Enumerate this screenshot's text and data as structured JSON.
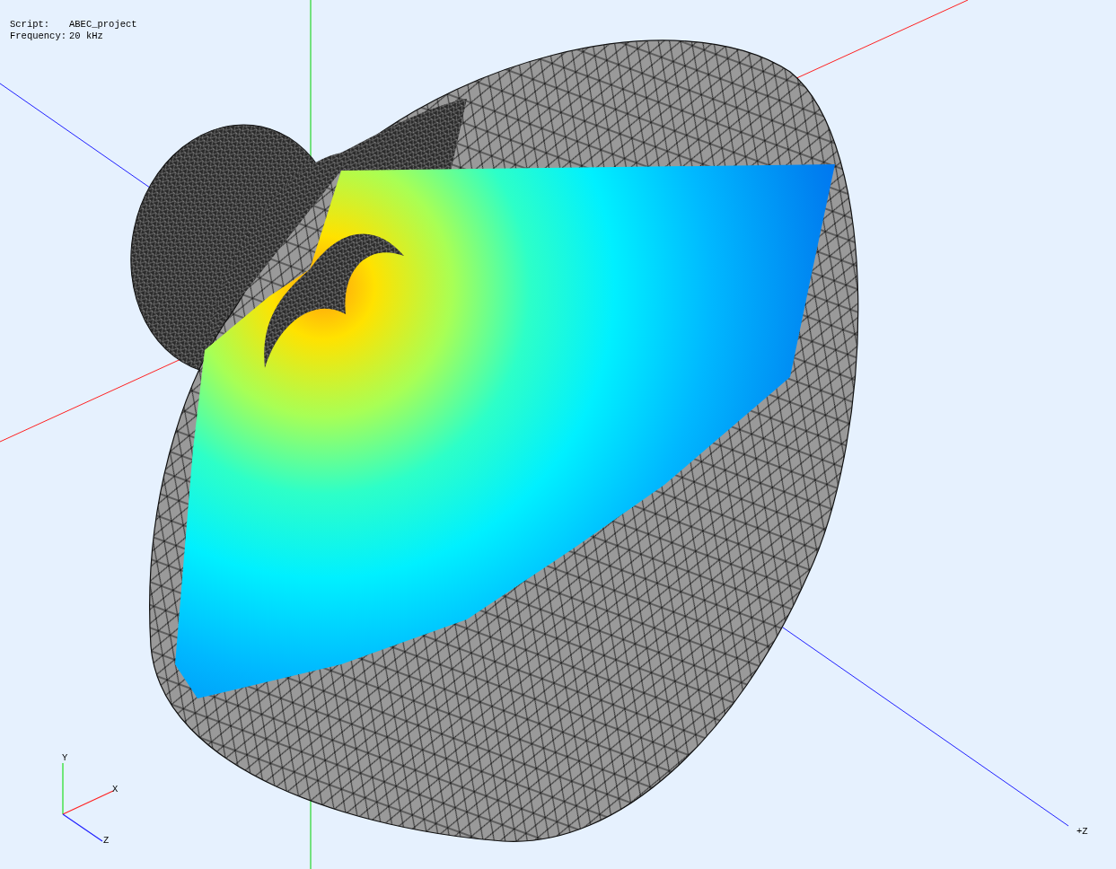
{
  "info": [
    {
      "label": "Script:",
      "value": "ABEC_project"
    },
    {
      "label": "Frequency:",
      "value": "20 kHz"
    }
  ],
  "axis_label": "+Z",
  "triad": {
    "x": "X",
    "y": "Y",
    "z": "Z"
  }
}
